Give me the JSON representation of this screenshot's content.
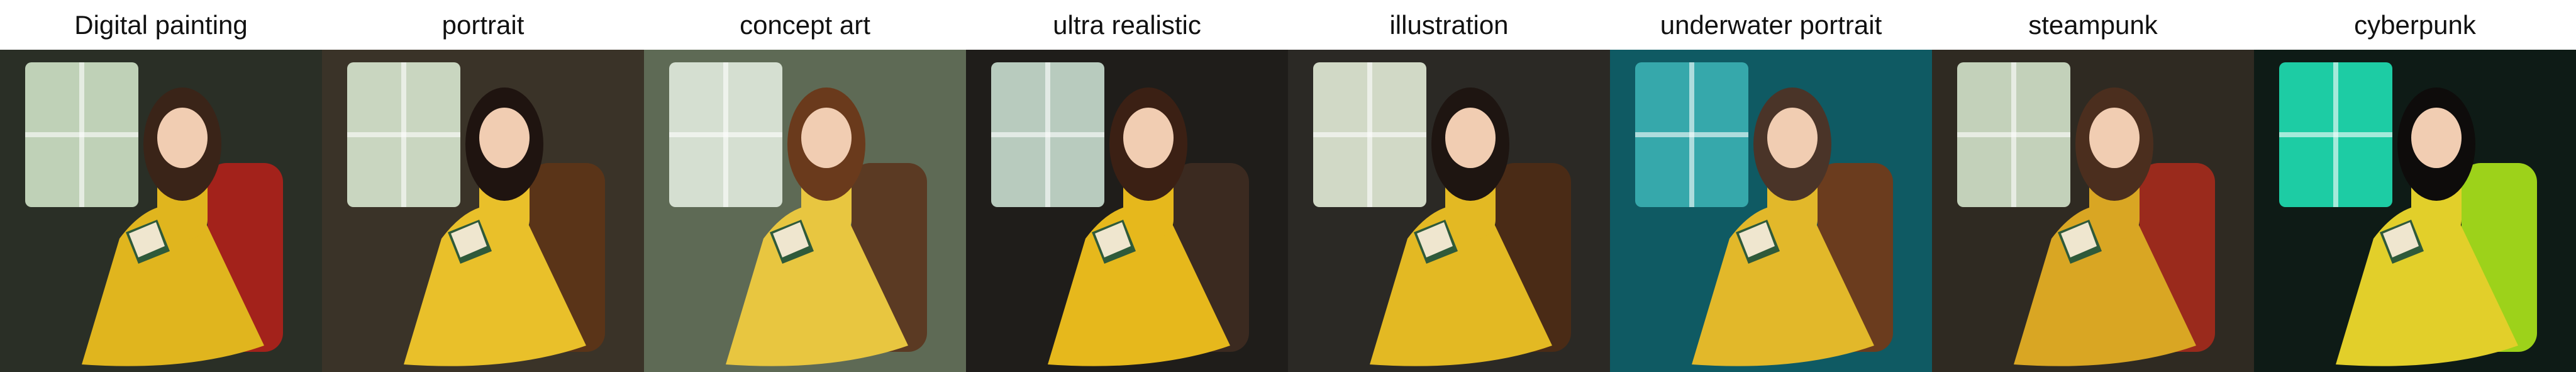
{
  "panels": [
    {
      "caption": "Digital painting",
      "wall": "#2a2f26",
      "window": "#cfe3c8",
      "dress": "#e0b51e",
      "accent": "#a3221b",
      "hair": "#3a2418"
    },
    {
      "caption": "portrait",
      "wall": "#3a3328",
      "window": "#d9e8d0",
      "dress": "#e9c02a",
      "accent": "#5a3418",
      "hair": "#1f1410"
    },
    {
      "caption": "concept art",
      "wall": "#5e6a55",
      "window": "#e2ecdf",
      "dress": "#e8c640",
      "accent": "#5b3a23",
      "hair": "#6a3a1c"
    },
    {
      "caption": "ultra realistic",
      "wall": "#1f1d1a",
      "window": "#c9dfd0",
      "dress": "#e6b81c",
      "accent": "#3b2a20",
      "hair": "#3b2014"
    },
    {
      "caption": "illustration",
      "wall": "#2b2925",
      "window": "#e3ecd8",
      "dress": "#e3b923",
      "accent": "#4a2b16",
      "hair": "#1e1511"
    },
    {
      "caption": "underwater portrait",
      "wall": "#0f5a63",
      "window": "#3bb0b2",
      "dress": "#e2b82a",
      "accent": "#6b3c1e",
      "hair": "#4a3428"
    },
    {
      "caption": "steampunk",
      "wall": "#2f2a22",
      "window": "#d4e3cb",
      "dress": "#d9a623",
      "accent": "#9a2a1c",
      "hair": "#4b2e1e"
    },
    {
      "caption": "cyberpunk",
      "wall": "#0e1b16",
      "window": "#1fe0b4",
      "dress": "#e2cf2a",
      "accent": "#9dd21a",
      "hair": "#0e0c0b"
    }
  ]
}
